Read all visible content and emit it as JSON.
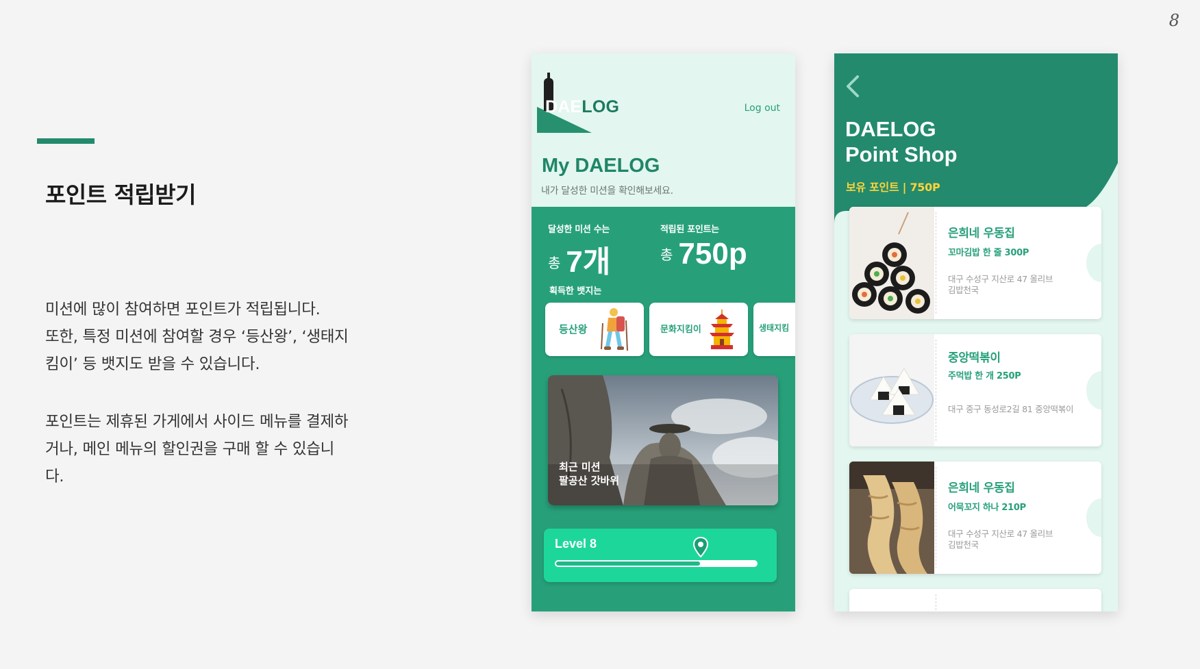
{
  "slide": {
    "page_number": "8",
    "title": "포인트 적립받기",
    "paragraph1": [
      "미션에 많이 참여하면 포인트가 적립됩니다.",
      "또한, 특정 미션에 참여할 경우 ‘등산왕’, ‘생태지",
      "킴이’ 등 뱃지도 받을 수 있습니다."
    ],
    "paragraph2": [
      "포인트는 제휴된 가게에서 사이드 메뉴를 결제하",
      "거나, 메인 메뉴의 할인권을 구매 할 수 있습니",
      "다."
    ]
  },
  "my_daelog": {
    "logo_part1": "DAE",
    "logo_part2": "LOG",
    "logout": "Log out",
    "title": "My DAELOG",
    "subtitle": "내가 달성한 미션을 확인해보세요.",
    "missions_label": "달성한 미션 수는",
    "missions_prefix": "총",
    "missions_value": "7개",
    "points_label": "적립된 포인트는",
    "points_prefix": "총",
    "points_value": "750p",
    "badges_heading": "획득한 뱃지는",
    "badges": [
      {
        "label": "등산왕",
        "icon": "hiker-icon"
      },
      {
        "label": "문화지킴이",
        "icon": "pagoda-icon"
      },
      {
        "label": "생태지킴"
      }
    ],
    "recent_mission_label": "최근 미션",
    "recent_mission_name": "팔공산 갓바위",
    "level_label": "Level 8",
    "level_progress": 0.72,
    "colors": {
      "primary": "#27a07a",
      "light_bg": "#e3f6ef",
      "level_green": "#1dd79a"
    }
  },
  "point_shop": {
    "title_line1": "DAELOG",
    "title_line2": "Point Shop",
    "points_label": "보유 포인트 |  750P",
    "items": [
      {
        "name": "은희네 우동집",
        "item": "꼬마김밥 한 줄 300P",
        "address_line1": "대구 수성구 지산로 47 올리브",
        "address_line2": "김밥천국"
      },
      {
        "name": "중앙떡볶이",
        "item": "주먹밥 한 개 250P",
        "address_line1": "대구 중구 동성로2길 81 중앙떡볶이",
        "address_line2": ""
      },
      {
        "name": "은희네 우동집",
        "item": "어묵꼬지 하나 210P",
        "address_line1": "대구 수성구 지산로 47 올리브",
        "address_line2": "김밥천국"
      }
    ],
    "colors": {
      "header": "#238a6d",
      "accent": "#ffd43b"
    }
  }
}
